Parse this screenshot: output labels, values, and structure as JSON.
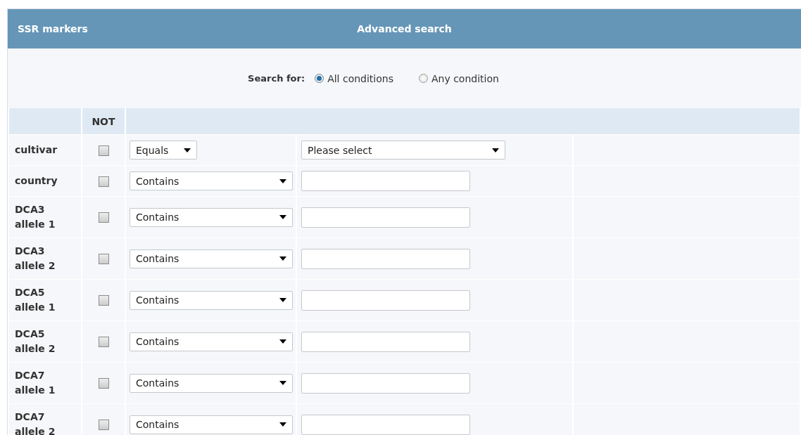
{
  "panel": {
    "title": "SSR markers",
    "heading": "Advanced search"
  },
  "search_for": {
    "label": "Search for:",
    "options": [
      {
        "label": "All conditions",
        "selected": true
      },
      {
        "label": "Any condition",
        "selected": false
      }
    ]
  },
  "table": {
    "not_header": "NOT",
    "rows": [
      {
        "label": "cultivar",
        "not_checked": false,
        "operator": "Equals",
        "kind": "select",
        "value": "Please select"
      },
      {
        "label": "country",
        "not_checked": false,
        "operator": "Contains",
        "kind": "text"
      },
      {
        "label": "DCA3 allele 1",
        "not_checked": false,
        "operator": "Contains",
        "kind": "text"
      },
      {
        "label": "DCA3 allele 2",
        "not_checked": false,
        "operator": "Contains",
        "kind": "text"
      },
      {
        "label": "DCA5 allele 1",
        "not_checked": false,
        "operator": "Contains",
        "kind": "text"
      },
      {
        "label": "DCA5 allele 2",
        "not_checked": false,
        "operator": "Contains",
        "kind": "text"
      },
      {
        "label": "DCA7 allele 1",
        "not_checked": false,
        "operator": "Contains",
        "kind": "text"
      },
      {
        "label": "DCA7 allele 2",
        "not_checked": false,
        "operator": "Contains",
        "kind": "text"
      }
    ]
  }
}
